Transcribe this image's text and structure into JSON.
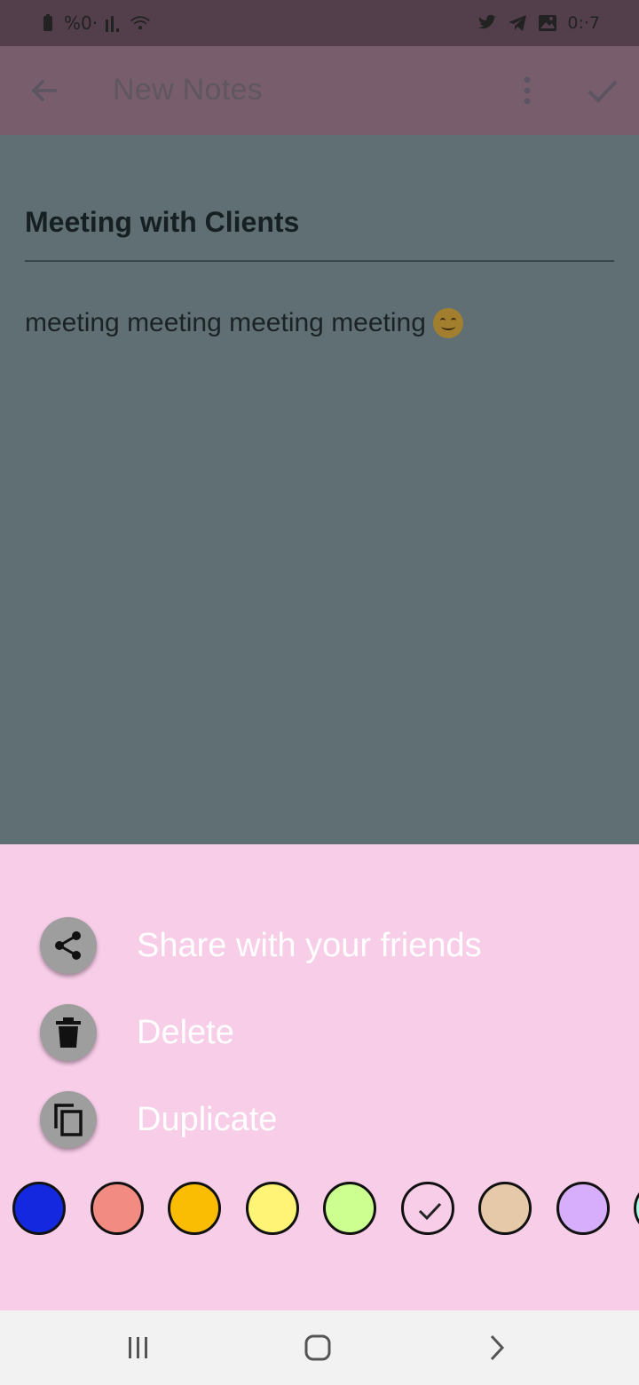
{
  "status_bar": {
    "left_text": "%0·",
    "time": "0:·7",
    "icons_left": [
      "battery-icon",
      "signal-icon",
      "wifi-icon"
    ],
    "icons_right": [
      "twitter-icon",
      "telegram-icon",
      "gallery-icon"
    ]
  },
  "app_bar": {
    "title": "New Notes",
    "background": "#785e6d",
    "icons": [
      "back-arrow-icon",
      "more-vert-icon",
      "check-icon"
    ]
  },
  "note": {
    "title": "Meeting with Clients",
    "body": "meeting meeting meeting meeting",
    "emoji": "smiling-face-icon"
  },
  "sheet": {
    "background": "#f8cde8",
    "actions": [
      {
        "label": "Share with your friends",
        "icon": "share-icon"
      },
      {
        "label": "Delete",
        "icon": "trash-icon"
      },
      {
        "label": "Duplicate",
        "icon": "copy-icon"
      }
    ],
    "colors": [
      {
        "hex": "#1428e0",
        "selected": false
      },
      {
        "hex": "#f28b82",
        "selected": false
      },
      {
        "hex": "#fbbc04",
        "selected": false
      },
      {
        "hex": "#fff475",
        "selected": false
      },
      {
        "hex": "#ccff90",
        "selected": false
      },
      {
        "hex": "#f8cde8",
        "selected": true
      },
      {
        "hex": "#e6c9a8",
        "selected": false
      },
      {
        "hex": "#d7aefb",
        "selected": false
      },
      {
        "hex": "#a7ffeb",
        "selected": false
      }
    ]
  },
  "nav_bar": {
    "buttons": [
      "recents-icon",
      "home-icon",
      "back-chevron-icon"
    ]
  }
}
